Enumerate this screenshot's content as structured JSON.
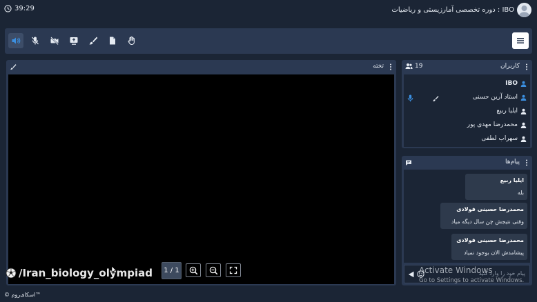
{
  "header": {
    "timer": "39:29",
    "title": "IBO : دوره تخصصی آمارزیستی و ریاضیات"
  },
  "board": {
    "title": "تخته",
    "page_indicator": "1 / 1",
    "watermark": "/Iran_biology_olympiad"
  },
  "users": {
    "title": "کاربران",
    "count": "19",
    "list": [
      "IBO",
      "استاد آرین حسنی",
      "ایلیا ربیع",
      "محمدرضا مهدی پور",
      "سهراب لطفی"
    ]
  },
  "messages": {
    "title": "پیام‌ها",
    "items": [
      {
        "sender": "ایلیا ربیع",
        "text": "بله"
      },
      {
        "sender": "محمدرضا حسینی فولادی",
        "text": "وقتی نتیجش چن سال دیگه میاد"
      },
      {
        "sender": "محمدرضا حسینی فولادی",
        "text": "پیشامدش الان بوجود نمیاد"
      }
    ],
    "input_placeholder": "پیام خود را وارد کنید"
  },
  "overlay": {
    "activate_title": "Activate Windows",
    "activate_sub": "Go to Settings to activate Windows."
  },
  "footer": {
    "brand": "© اسکای‌روم™"
  },
  "colors": {
    "background": "#1b2535",
    "panel": "#2b3952",
    "accent": "#3b8fe0"
  }
}
